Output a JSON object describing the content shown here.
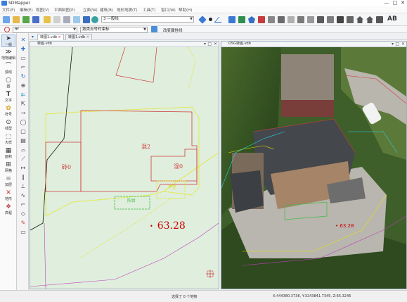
{
  "window": {
    "title": "SDMapper",
    "controls": [
      "—",
      "□",
      "✕"
    ]
  },
  "menu": [
    "文件(F)",
    "编辑(E)",
    "视图(V)",
    "平面制图(P)",
    "立面(W)",
    "建筑(B)",
    "地形地貌(T)",
    "工具(T)",
    "窗口(W)",
    "帮助(H)"
  ],
  "toolbar": {
    "layer_select": "3 —般线",
    "feature_select": "fff",
    "snap_select": "按类点号约束标",
    "attr_button": "改变属性线",
    "ab_label": "AB"
  },
  "leftpanel": [
    {
      "label": "一般",
      "icon": "pointer-icon"
    },
    {
      "label": "地物编辑",
      "icon": "edit-icon"
    },
    {
      "label": "弧线",
      "icon": "arc-icon"
    },
    {
      "label": "圆",
      "icon": "circle-icon"
    },
    {
      "label": "文字",
      "icon": "text-icon"
    },
    {
      "label": "符号",
      "icon": "symbol-icon"
    },
    {
      "label": "线型",
      "icon": "linetype-icon"
    },
    {
      "label": "大样",
      "icon": "dashed-box-icon"
    },
    {
      "label": "面积",
      "icon": "area-icon"
    },
    {
      "label": "网格",
      "icon": "grid-icon"
    },
    {
      "label": "加层",
      "icon": "layer-icon"
    },
    {
      "label": "地形",
      "icon": "terrain-icon"
    },
    {
      "label": "高程",
      "icon": "elevation-icon"
    }
  ],
  "doc_tabs": [
    "转图1.vdb",
    "转图1.vdb"
  ],
  "panes": {
    "left_title": "转图.vdb",
    "right_title": "OSG转图.vdb"
  },
  "map": {
    "labels": {
      "mix2": "混2",
      "brick0": "砖0",
      "mix0": "混0",
      "yellow1": "平空",
      "green1": "阳台"
    },
    "elevation_left": "63.28",
    "elevation_right": "63.28",
    "colors": {
      "building": "#d23a3a",
      "boundary": "#e6e600",
      "contour": "#c040c0",
      "road": "#111111",
      "elev": "#cc0000"
    }
  },
  "status": {
    "selection": "选择了 0 个地物",
    "coords": "X:444380.3738, Y:3243841.7345, Z:65.3246"
  }
}
